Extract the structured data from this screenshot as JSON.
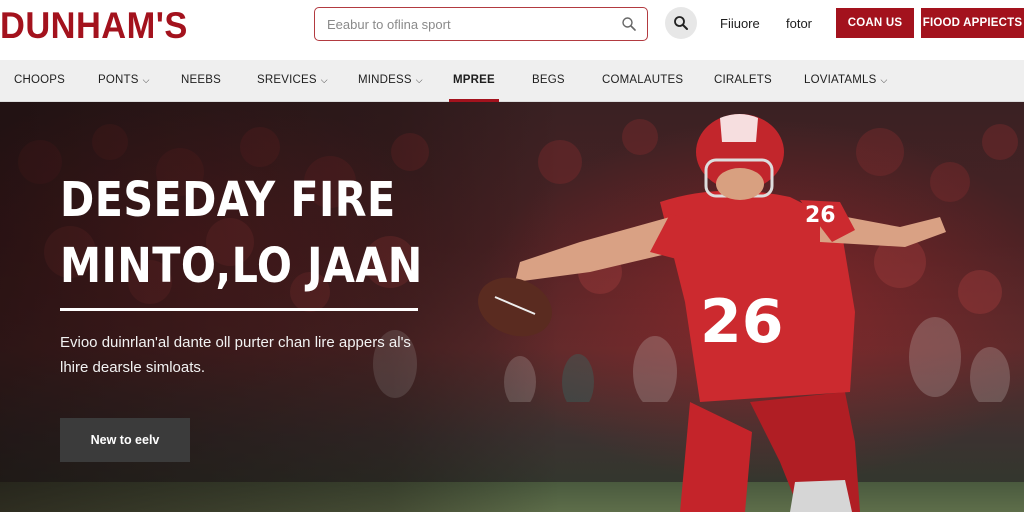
{
  "brand": {
    "logo_text": "DUNHAM'S",
    "accent": "#a3121d"
  },
  "header": {
    "search_placeholder": "Eeabur to oflina sport",
    "links": [
      "Fiiuore",
      "fotor"
    ],
    "buttons": [
      "COAN US",
      "FIOOD APPIECTS"
    ]
  },
  "nav": {
    "items": [
      {
        "label": "CHOOPS",
        "dropdown": false
      },
      {
        "label": "PONTS",
        "dropdown": true
      },
      {
        "label": "NEEBS",
        "dropdown": false
      },
      {
        "label": "SREVICES",
        "dropdown": true
      },
      {
        "label": "MINDESS",
        "dropdown": true
      },
      {
        "label": "MPREE",
        "dropdown": false,
        "active": true
      },
      {
        "label": "BEGS",
        "dropdown": false
      },
      {
        "label": "COMALAUTES",
        "dropdown": false
      },
      {
        "label": "CIRALETS",
        "dropdown": false
      },
      {
        "label": "LOVIATAMLS",
        "dropdown": true
      }
    ]
  },
  "hero": {
    "title_line1": "DESEDAY FIRE",
    "title_line2": "MINTO,LO JAAN",
    "subtitle": "Evioo duinrlan'al dante oll purter chan lire appers al's lhire dearsle simloats.",
    "cta_label": "New to eelv",
    "jersey_number": "26"
  }
}
